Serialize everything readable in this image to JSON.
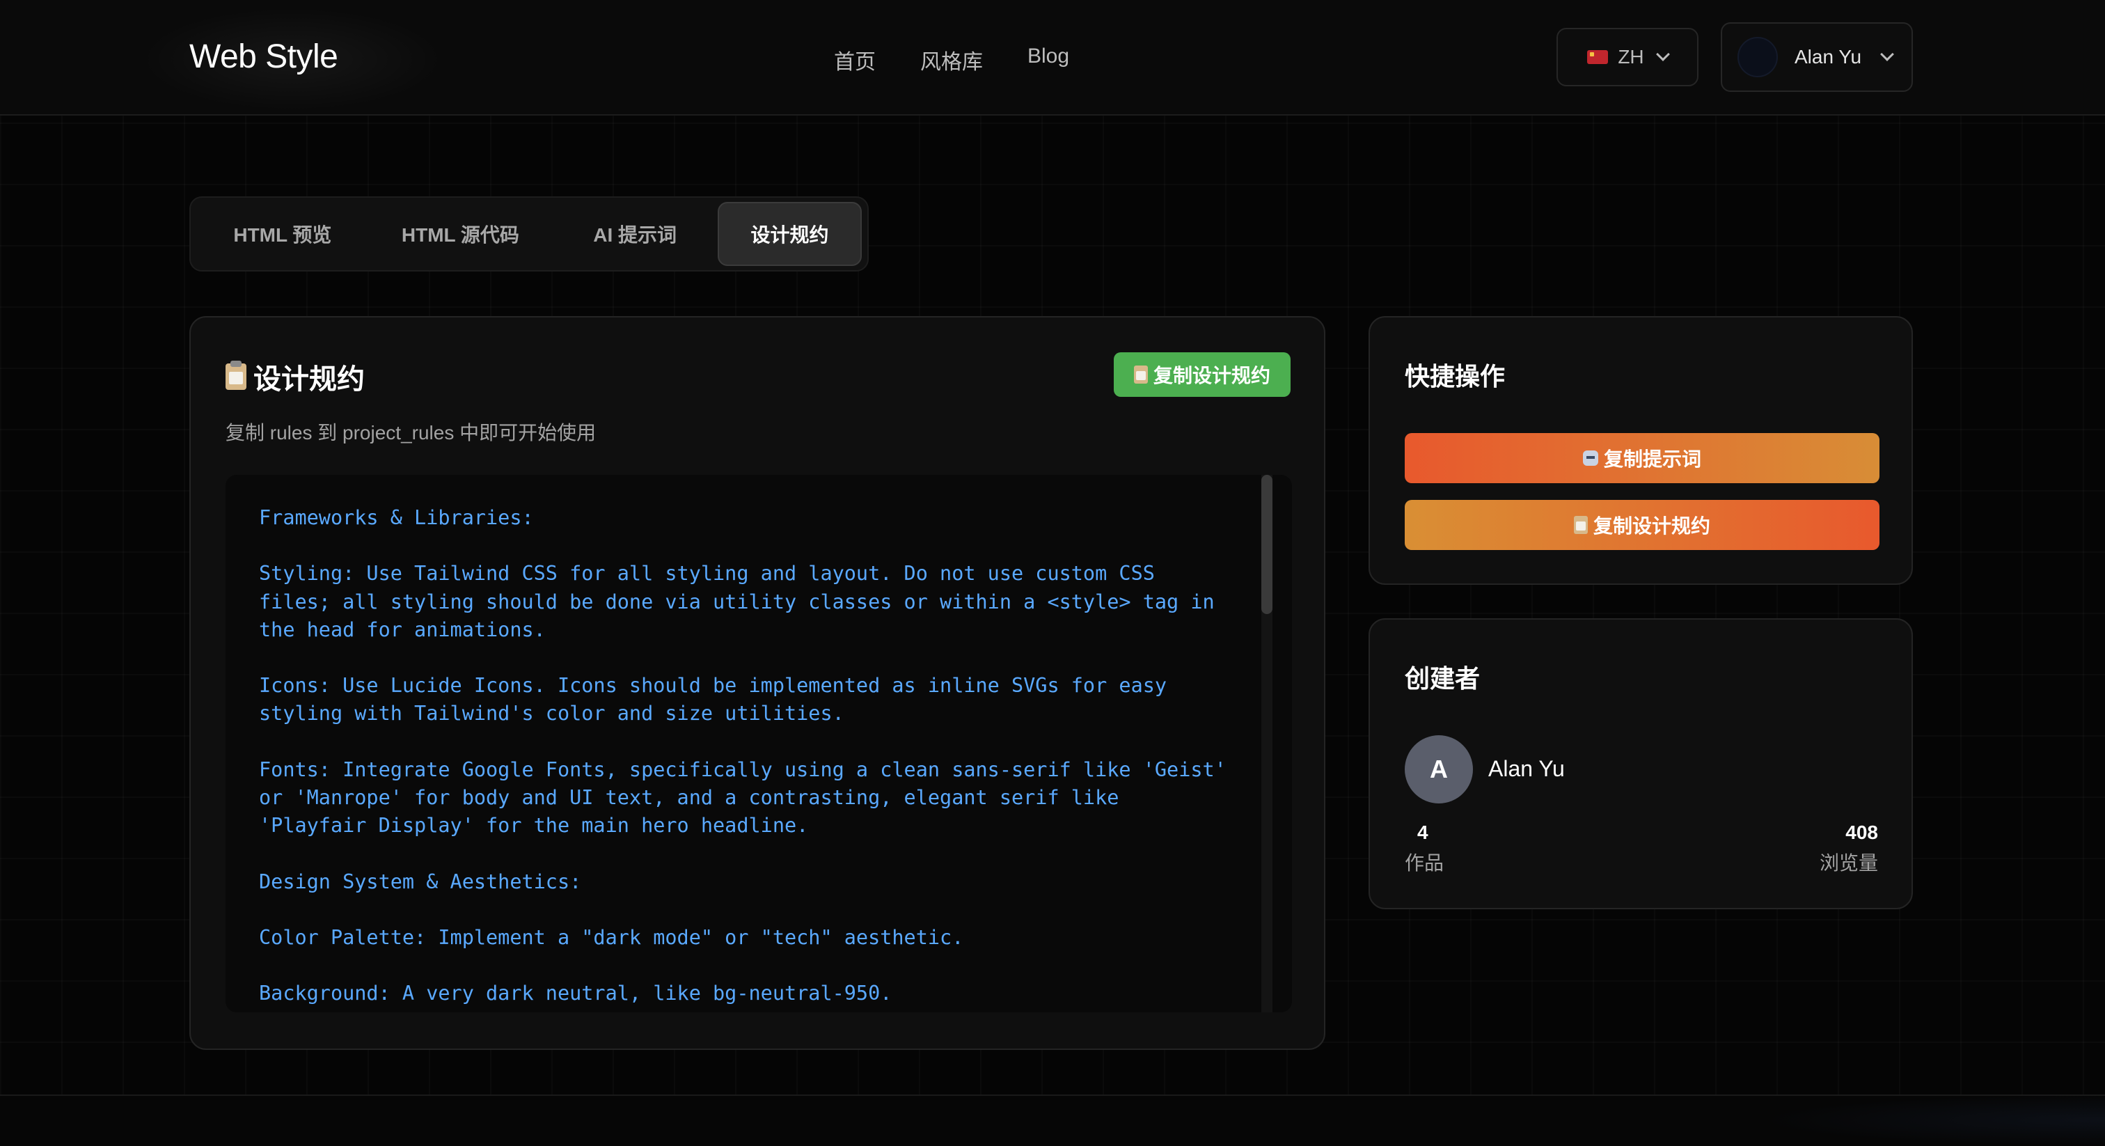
{
  "header": {
    "logo": "Web Style",
    "nav": [
      "首页",
      "风格库",
      "Blog"
    ],
    "language": "ZH",
    "user_name": "Alan Yu"
  },
  "tabs": [
    {
      "label": "HTML 预览",
      "active": false
    },
    {
      "label": "HTML 源代码",
      "active": false
    },
    {
      "label": "AI 提示词",
      "active": false
    },
    {
      "label": "设计规约",
      "active": true
    }
  ],
  "main": {
    "title": "设计规约",
    "copy_button": "复制设计规约",
    "subtitle": "复制 rules 到 project_rules 中即可开始使用",
    "code": "Frameworks & Libraries:\n\nStyling: Use Tailwind CSS for all styling and layout. Do not use custom CSS files; all styling should be done via utility classes or within a <style> tag in the head for animations.\n\nIcons: Use Lucide Icons. Icons should be implemented as inline SVGs for easy styling with Tailwind's color and size utilities.\n\nFonts: Integrate Google Fonts, specifically using a clean sans-serif like 'Geist' or 'Manrope' for body and UI text, and a contrasting, elegant serif like 'Playfair Display' for the main hero headline.\n\nDesign System & Aesthetics:\n\nColor Palette: Implement a \"dark mode\" or \"tech\" aesthetic.\n\nBackground: A very dark neutral, like bg-neutral-950."
  },
  "quick_actions": {
    "title": "快捷操作",
    "copy_prompt": "复制提示词",
    "copy_rules": "复制设计规约"
  },
  "creator": {
    "title": "创建者",
    "avatar_letter": "A",
    "name": "Alan Yu",
    "works_count": "4",
    "works_label": "作品",
    "views_count": "408",
    "views_label": "浏览量"
  },
  "colors": {
    "accent_green": "#4caf50",
    "accent_orange": "#e8592d",
    "accent_amber": "#d88d36",
    "code_blue": "#5aa9ff"
  }
}
